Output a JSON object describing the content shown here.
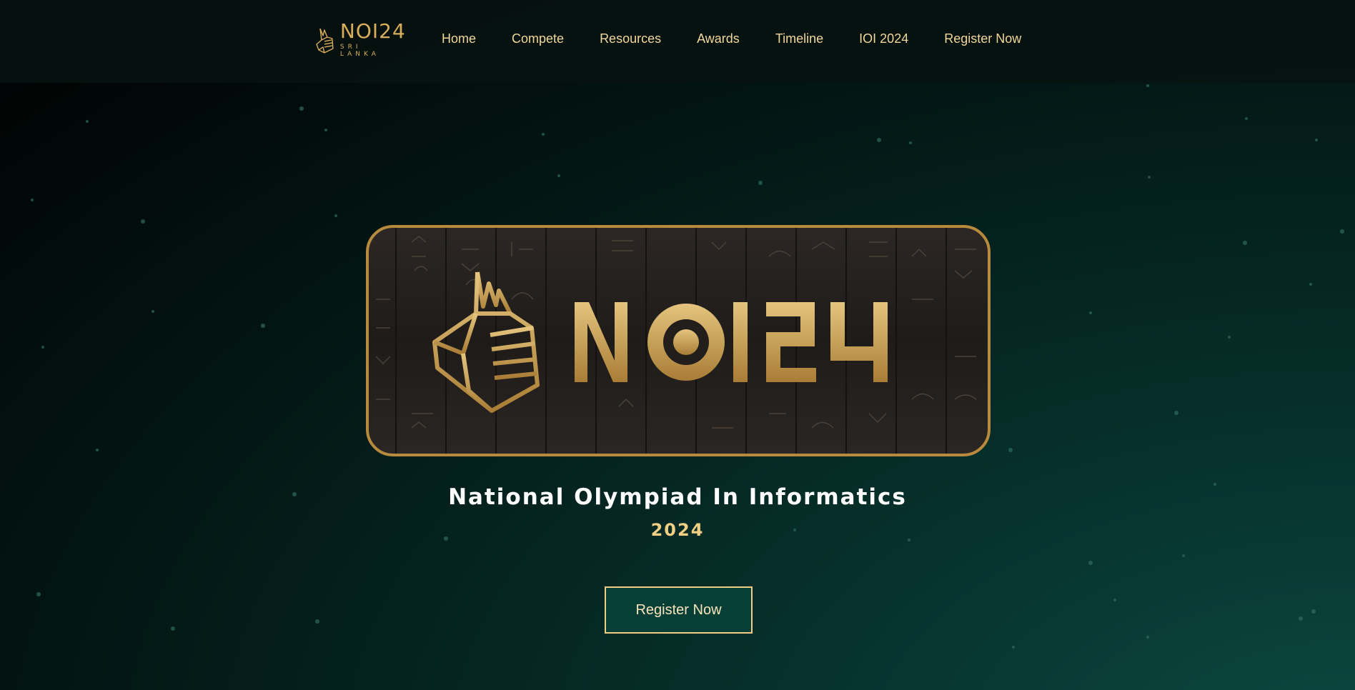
{
  "nav": {
    "logo": {
      "title_bold": "NOI",
      "title_light": "24",
      "subtitle": "SRI LANKA"
    },
    "items": [
      {
        "label": "Home"
      },
      {
        "label": "Compete"
      },
      {
        "label": "Resources"
      },
      {
        "label": "Awards"
      },
      {
        "label": "Timeline"
      },
      {
        "label": "IOI 2024"
      },
      {
        "label": "Register Now"
      }
    ]
  },
  "hero": {
    "banner_text": "NOI24",
    "banner_icon": "geometric-sphinx-cat-head-icon",
    "title": "National Olympiad In Informatics",
    "year": "2024",
    "cta_label": "Register Now"
  },
  "colors": {
    "accent_gold": "#d8ad5c",
    "nav_text": "#f2d79a",
    "cta_bg": "#073f37",
    "background_dark": "#000000",
    "background_teal": "#0c4a40"
  }
}
